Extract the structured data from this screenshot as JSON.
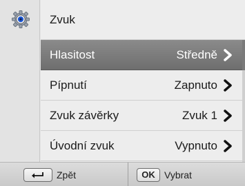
{
  "sidebar": {
    "icon": "gear-icon"
  },
  "menu": {
    "title": "Zvuk",
    "items": [
      {
        "label": "Hlasitost",
        "value": "Středně",
        "selected": true
      },
      {
        "label": "Pípnutí",
        "value": "Zapnuto",
        "selected": false
      },
      {
        "label": "Zvuk závěrky",
        "value": "Zvuk 1",
        "selected": false
      },
      {
        "label": "Úvodní zvuk",
        "value": "Vypnuto",
        "selected": false
      }
    ]
  },
  "footer": {
    "back_key_icon": "return-arrow-icon",
    "back_label": "Zpět",
    "ok_key": "OK",
    "select_label": "Vybrat"
  },
  "colors": {
    "selected_bg": "#7a7a7a",
    "gear_blue": "#1f5bd6"
  }
}
